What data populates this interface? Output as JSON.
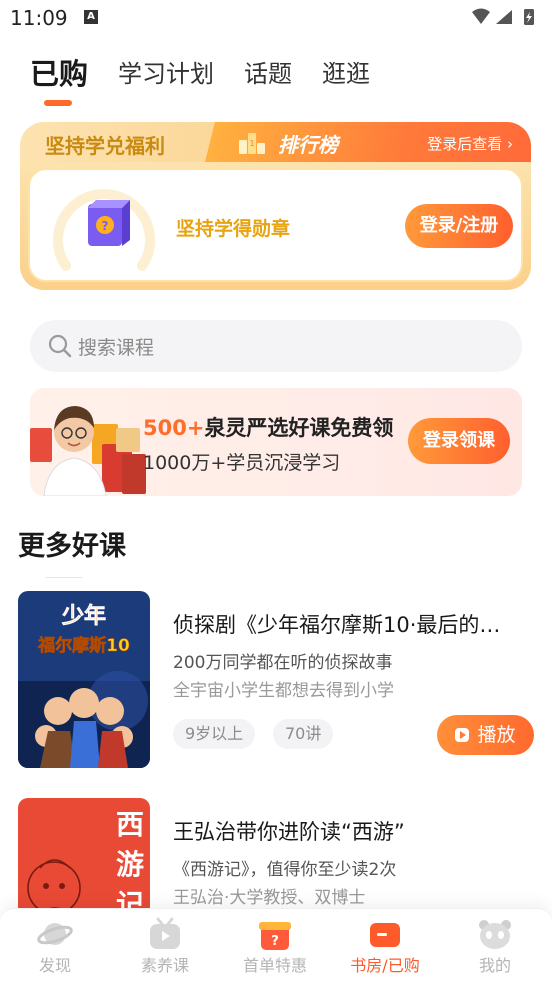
{
  "status_bar": {
    "time": "11:09",
    "notification_letter": "A"
  },
  "top_tabs": [
    {
      "label": "已购",
      "active": true
    },
    {
      "label": "学习计划",
      "active": false
    },
    {
      "label": "话题",
      "active": false
    },
    {
      "label": "逛逛",
      "active": false
    }
  ],
  "perks": {
    "title": "坚持学兑福利",
    "ranking_label": "排行榜",
    "login_hint": "登录后查看 ›",
    "badge_label": "坚持学得勋章",
    "login_button": "登录/注册"
  },
  "search": {
    "placeholder": "搜索课程"
  },
  "promo": {
    "accent": "500+",
    "line1_rest": "泉灵严选好课免费领",
    "line2": "1000万+学员沉浸学习",
    "button": "登录领课"
  },
  "section": {
    "title": "更多好课"
  },
  "courses": [
    {
      "title": "侦探剧《少年福尔摩斯10·最后的…",
      "subtitle": "200万同学都在听的侦探故事",
      "description": "全宇宙小学生都想去得到小学",
      "tags": [
        "9岁以上",
        "70讲"
      ],
      "play_label": "播放",
      "cover_text": [
        "少年",
        "福尔摩斯10"
      ]
    },
    {
      "title": "王弘治带你进阶读“西游”",
      "subtitle": "《西游记》，值得你至少读2次",
      "description": "王弘治·大学教授、双博士",
      "cover_text": [
        "西",
        "游",
        "记"
      ]
    }
  ],
  "bottom_nav": [
    {
      "label": "发现",
      "icon": "planet-icon",
      "active": false
    },
    {
      "label": "素养课",
      "icon": "tv-icon",
      "active": false
    },
    {
      "label": "首单特惠",
      "icon": "gift-icon",
      "active": false
    },
    {
      "label": "书房/已购",
      "icon": "bookshelf-icon",
      "active": true
    },
    {
      "label": "我的",
      "icon": "panda-icon",
      "active": false
    }
  ],
  "colors": {
    "accent": "#ff6a2a",
    "gold": "#e8a312",
    "inactive": "#b5b5b5"
  }
}
